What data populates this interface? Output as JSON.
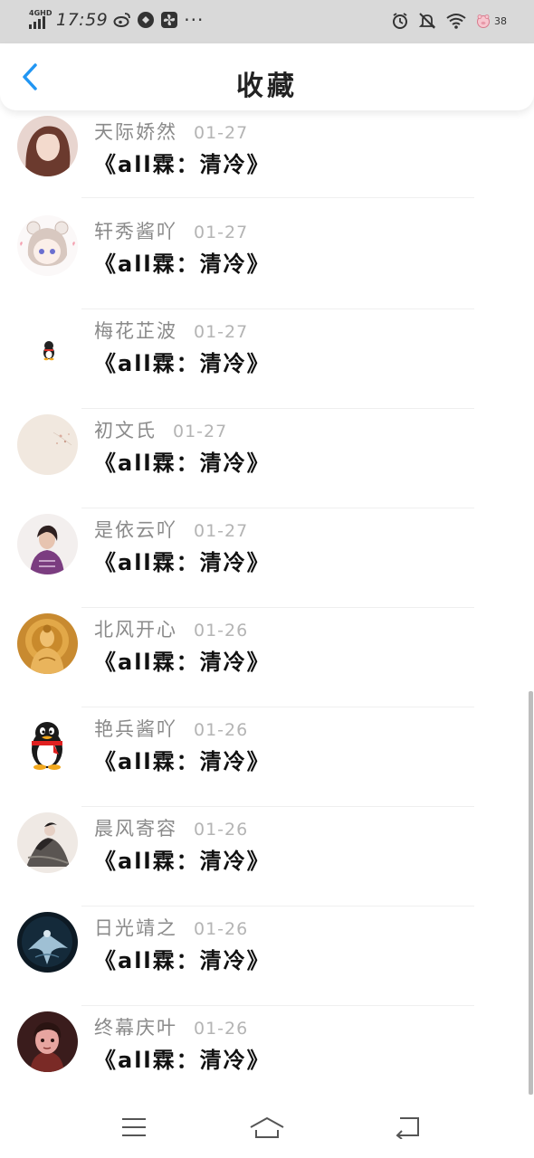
{
  "status_bar": {
    "network": "4GHD",
    "time": "17:59",
    "battery_level": "38",
    "icons": [
      "weibo-icon",
      "app-icon",
      "fan-icon",
      "more-dots-icon",
      "alarm-icon",
      "mute-icon",
      "wifi-icon",
      "battery-icon"
    ]
  },
  "header": {
    "title": "收藏",
    "back_icon": "chevron-left-icon",
    "accent_color": "#2196f3"
  },
  "items": [
    {
      "user": "天际娇然",
      "date": "01-27",
      "title": "《all霖：清冷》",
      "avatar": "photo-girl"
    },
    {
      "user": "轩秀酱吖",
      "date": "01-27",
      "title": "《all霖：清冷》",
      "avatar": "anime-bear"
    },
    {
      "user": "梅花芷波",
      "date": "01-27",
      "title": "《all霖：清冷》",
      "avatar": "small-penguin"
    },
    {
      "user": "初文氏",
      "date": "01-27",
      "title": "《all霖：清冷》",
      "avatar": "beige-floral"
    },
    {
      "user": "是依云吖",
      "date": "01-27",
      "title": "《all霖：清冷》",
      "avatar": "photo-person"
    },
    {
      "user": "北风开心",
      "date": "01-26",
      "title": "《all霖：清冷》",
      "avatar": "golden-buddha"
    },
    {
      "user": "艳兵酱吖",
      "date": "01-26",
      "title": "《all霖：清冷》",
      "avatar": "qq-penguin"
    },
    {
      "user": "晨风寄容",
      "date": "01-26",
      "title": "《all霖：清冷》",
      "avatar": "ink-painting"
    },
    {
      "user": "日光靖之",
      "date": "01-26",
      "title": "《all霖：清冷》",
      "avatar": "dark-figure"
    },
    {
      "user": "终幕庆叶",
      "date": "01-26",
      "title": "《all霖：清冷》",
      "avatar": "illustrated-portrait"
    }
  ],
  "nav_bar": {
    "icons": [
      "menu-icon",
      "home-icon",
      "back-icon"
    ]
  }
}
